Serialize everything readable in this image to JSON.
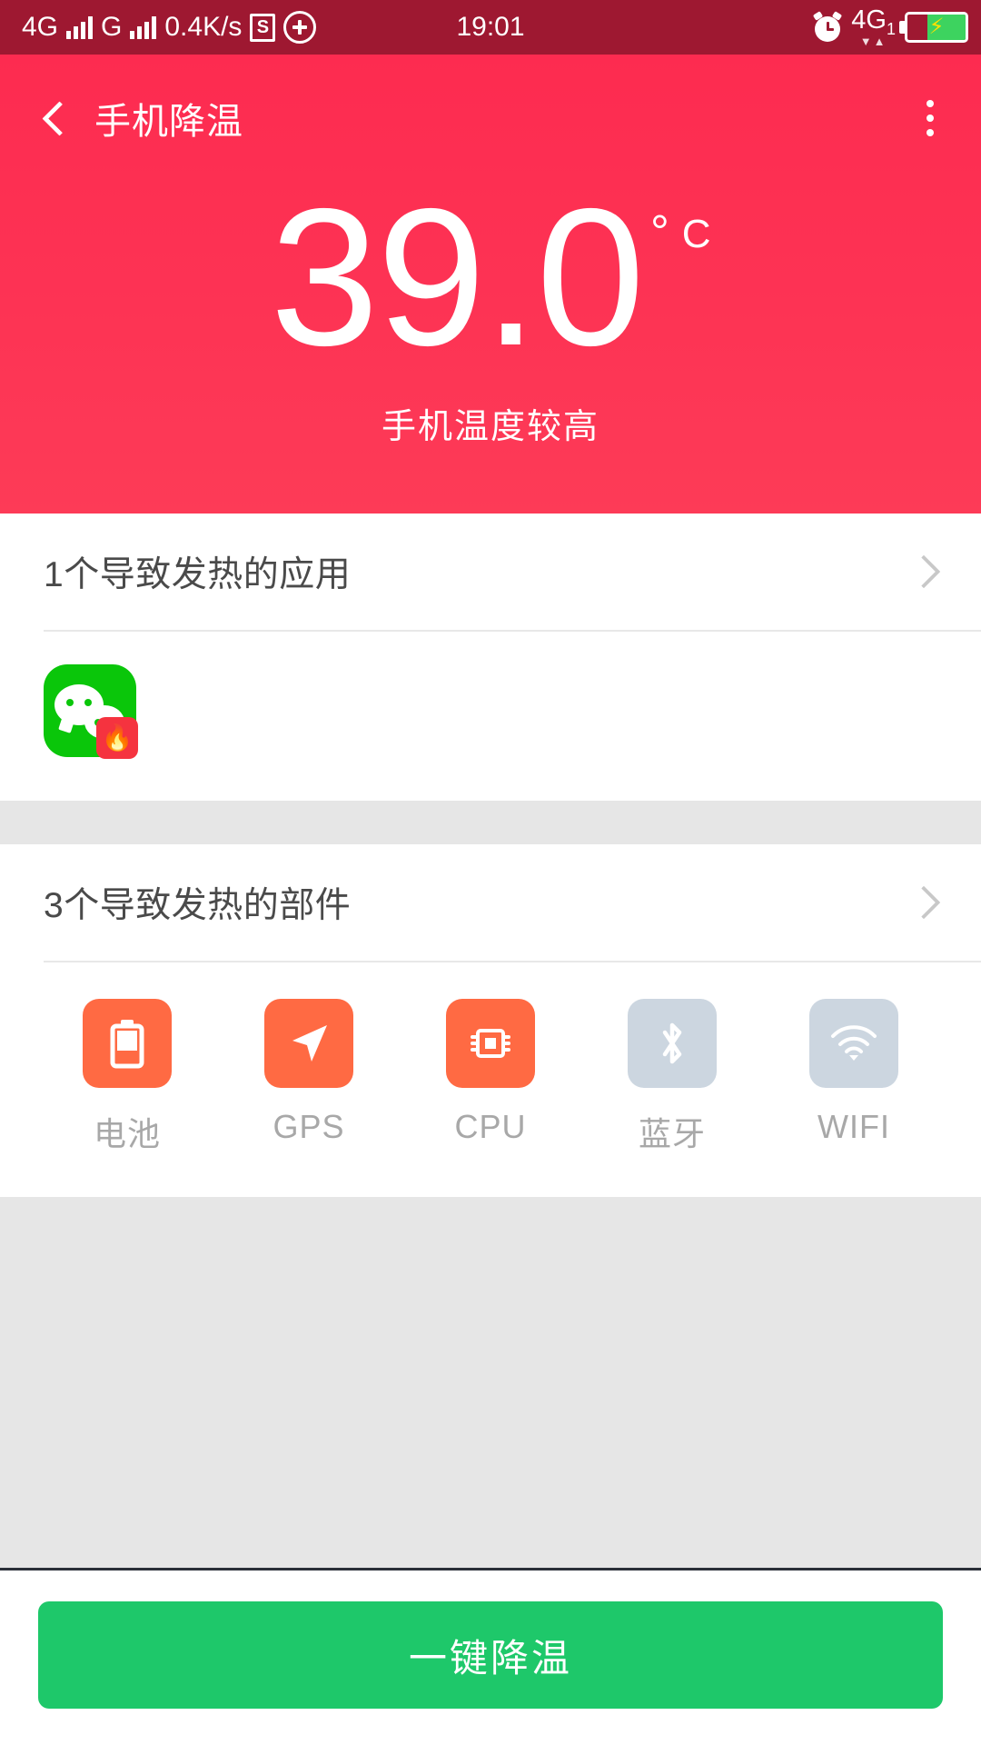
{
  "statusbar": {
    "network_type": "4G",
    "secondary_network": "G",
    "data_rate": "0.4K/s",
    "s_badge": "S",
    "plus_icon": "circled-plus-icon",
    "time": "19:01",
    "alarm_icon": "alarm-clock-icon",
    "sim2_label": "4G",
    "sim2_index": "1",
    "data_arrows": "▼▲",
    "battery_state": "charging",
    "battery_bolt": "⚡",
    "bg_color": "#9e1831"
  },
  "appbar": {
    "back_icon": "chevron-left-icon",
    "title": "手机降温",
    "menu_icon": "overflow-menu-icon"
  },
  "hero": {
    "temperature": "39.0",
    "degree_symbol": "°",
    "unit": "C",
    "status_text": "手机温度较高",
    "accent_color": "#fd2c50"
  },
  "apps_section": {
    "title": "1个导致发热的应用",
    "chevron_icon": "chevron-right-icon",
    "apps": [
      {
        "name": "WeChat",
        "icon": "wechat-icon",
        "badge_icon": "flame-icon",
        "badge_glyph": "🔥"
      }
    ]
  },
  "parts_section": {
    "title": "3个导致发热的部件",
    "chevron_icon": "chevron-right-icon",
    "items": [
      {
        "label": "电池",
        "icon": "battery-icon",
        "active": true,
        "color": "#ff6a43"
      },
      {
        "label": "GPS",
        "icon": "location-arrow-icon",
        "active": true,
        "color": "#ff6a43"
      },
      {
        "label": "CPU",
        "icon": "cpu-chip-icon",
        "active": true,
        "color": "#ff6a43"
      },
      {
        "label": "蓝牙",
        "icon": "bluetooth-icon",
        "active": false,
        "color": "#ccd6e0"
      },
      {
        "label": "WIFI",
        "icon": "wifi-icon",
        "active": false,
        "color": "#ccd6e0"
      }
    ]
  },
  "footer": {
    "cta_label": "一键降温",
    "cta_color": "#1ec86a"
  }
}
